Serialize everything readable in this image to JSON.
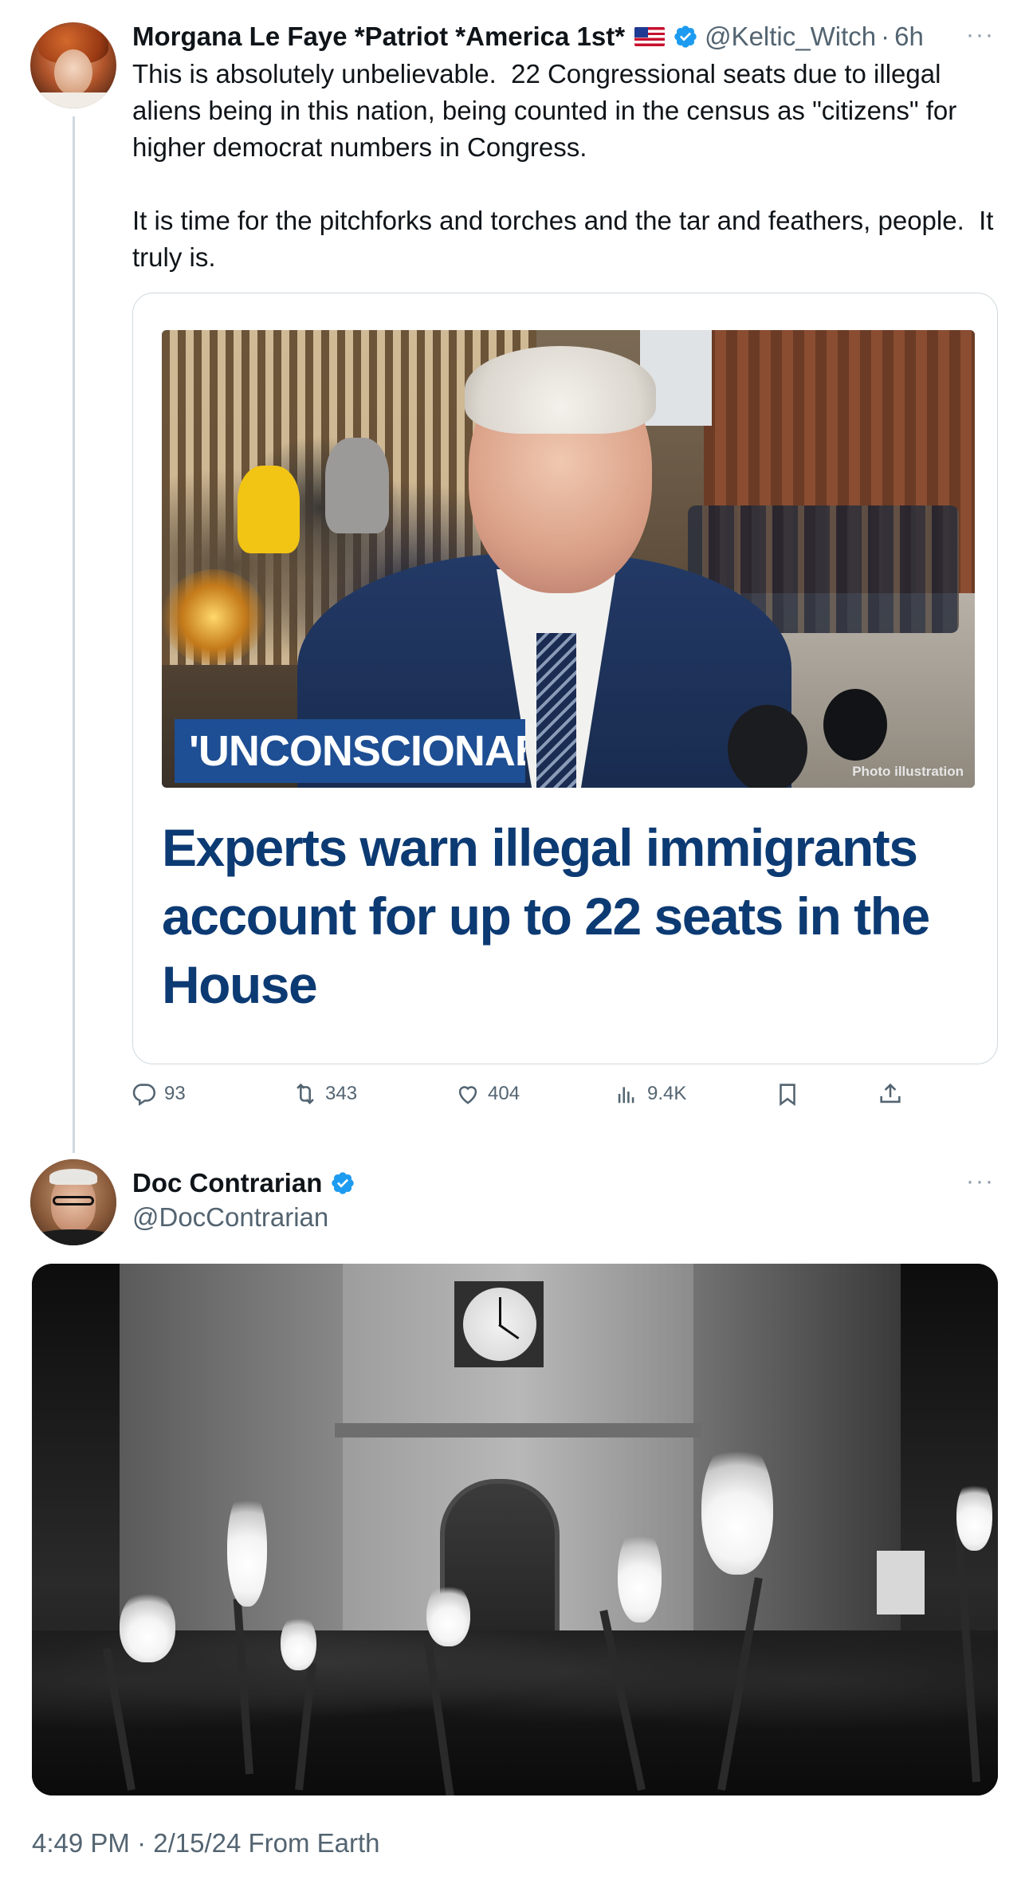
{
  "tweet1": {
    "display_name": "Morgana Le Faye *Patriot *America 1st*",
    "flag_icon": "us-flag-icon",
    "handle": "@Keltic_Witch",
    "separator": "·",
    "time": "6h",
    "text": "This is absolutely unbelievable.  22 Congressional seats due to illegal aliens being in this nation, being counted in the census as \"citizens\" for higher democrat numbers in Congress.\n\nIt is time for the pitchforks and torches and the tar and feathers, people.  It truly is.",
    "more": "···",
    "card": {
      "banner": "'UNCONSCIONABLE'",
      "photo_credit": "Photo illustration",
      "headline": "Experts warn illegal immigrants account for up to 22 seats in the House"
    },
    "actions": {
      "replies": "93",
      "reposts": "343",
      "likes": "404",
      "views": "9.4K"
    }
  },
  "tweet2": {
    "display_name": "Doc Contrarian",
    "handle": "@DocContrarian",
    "more": "···"
  },
  "footer": {
    "timestamp": "4:49 PM · 2/15/24 From Earth"
  },
  "colors": {
    "verified": "#1d9bf0",
    "secondary_text": "#536471",
    "border": "#cfd9de",
    "headline_blue": "#0c3a73",
    "banner_blue": "#1e4e93"
  }
}
